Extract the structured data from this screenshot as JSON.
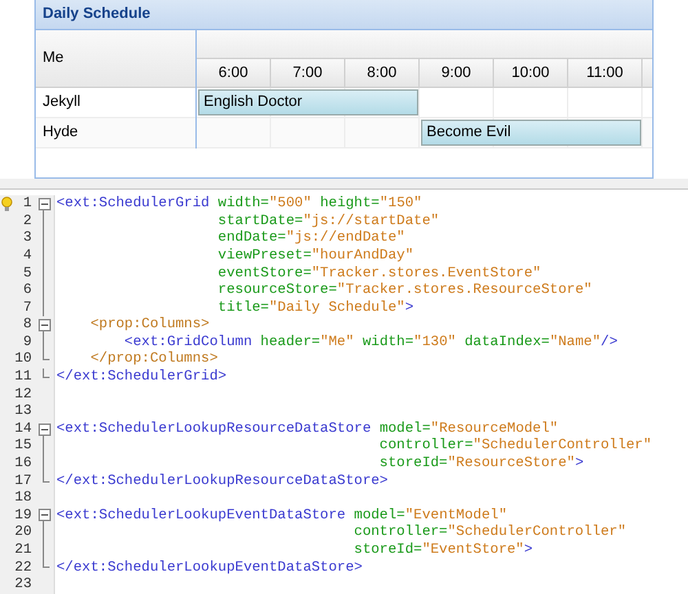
{
  "scheduler": {
    "title": "Daily Schedule",
    "resource_header": "Me",
    "hours": [
      "6:00",
      "7:00",
      "8:00",
      "9:00",
      "10:00",
      "11:00"
    ],
    "rows": [
      {
        "name": "Jekyll",
        "slots": [
          {
            "kind": "event_start",
            "text": "English Doctor"
          },
          {
            "kind": "event_cont"
          },
          {
            "kind": "event_cont"
          },
          {
            "kind": "empty"
          },
          {
            "kind": "empty"
          },
          {
            "kind": "empty"
          }
        ]
      },
      {
        "name": "Hyde",
        "slots": [
          {
            "kind": "empty"
          },
          {
            "kind": "empty"
          },
          {
            "kind": "empty"
          },
          {
            "kind": "event_start",
            "text": "Become Evil"
          },
          {
            "kind": "event_cont"
          },
          {
            "kind": "event_cont"
          }
        ]
      }
    ]
  },
  "editor": {
    "lines": [
      {
        "number": "1",
        "kind": "fold_start",
        "hint": true,
        "tokens": [
          {
            "kind": "tag",
            "text": "<ext:SchedulerGrid"
          },
          {
            "kind": "attr",
            "text": " width="
          },
          {
            "kind": "value",
            "text": "\"500\""
          },
          {
            "kind": "attr",
            "text": " height="
          },
          {
            "kind": "value",
            "text": "\"150\""
          }
        ]
      },
      {
        "number": "2",
        "kind": "fold_line",
        "tokens": [
          {
            "kind": "attr",
            "text": "                   startDate="
          },
          {
            "kind": "value",
            "text": "\"js://startDate\""
          }
        ]
      },
      {
        "number": "3",
        "kind": "fold_line",
        "tokens": [
          {
            "kind": "attr",
            "text": "                   endDate="
          },
          {
            "kind": "value",
            "text": "\"js://endDate\""
          }
        ]
      },
      {
        "number": "4",
        "kind": "fold_line",
        "tokens": [
          {
            "kind": "attr",
            "text": "                   viewPreset="
          },
          {
            "kind": "value",
            "text": "\"hourAndDay\""
          }
        ]
      },
      {
        "number": "5",
        "kind": "fold_line",
        "tokens": [
          {
            "kind": "attr",
            "text": "                   eventStore="
          },
          {
            "kind": "value",
            "text": "\"Tracker.stores.EventStore\""
          }
        ]
      },
      {
        "number": "6",
        "kind": "fold_line",
        "tokens": [
          {
            "kind": "attr",
            "text": "                   resourceStore="
          },
          {
            "kind": "value",
            "text": "\"Tracker.stores.ResourceStore\""
          }
        ]
      },
      {
        "number": "7",
        "kind": "fold_line",
        "tokens": [
          {
            "kind": "attr",
            "text": "                   title="
          },
          {
            "kind": "value",
            "text": "\"Daily Schedule\""
          },
          {
            "kind": "tag",
            "text": ">"
          }
        ]
      },
      {
        "number": "8",
        "kind": "fold_start",
        "tokens": [
          {
            "kind": "prop",
            "text": "    <prop:Columns>"
          }
        ]
      },
      {
        "number": "9",
        "kind": "fold_line",
        "tokens": [
          {
            "kind": "tag",
            "text": "        <ext:GridColumn"
          },
          {
            "kind": "attr",
            "text": " header="
          },
          {
            "kind": "value",
            "text": "\"Me\""
          },
          {
            "kind": "attr",
            "text": " width="
          },
          {
            "kind": "value",
            "text": "\"130\""
          },
          {
            "kind": "attr",
            "text": " dataIndex="
          },
          {
            "kind": "value",
            "text": "\"Name\""
          },
          {
            "kind": "tag",
            "text": "/>"
          }
        ]
      },
      {
        "number": "10",
        "kind": "fold_end",
        "tokens": [
          {
            "kind": "prop",
            "text": "    </prop:Columns>"
          }
        ]
      },
      {
        "number": "11",
        "kind": "fold_end",
        "tokens": [
          {
            "kind": "tag",
            "text": "</ext:SchedulerGrid>"
          }
        ]
      },
      {
        "number": "12",
        "kind": "plain"
      },
      {
        "number": "13",
        "kind": "plain"
      },
      {
        "number": "14",
        "kind": "fold_start",
        "tokens": [
          {
            "kind": "tag",
            "text": "<ext:SchedulerLookupResourceDataStore"
          },
          {
            "kind": "attr",
            "text": " model="
          },
          {
            "kind": "value",
            "text": "\"ResourceModel\""
          }
        ]
      },
      {
        "number": "15",
        "kind": "fold_line",
        "tokens": [
          {
            "kind": "attr",
            "text": "                                      controller="
          },
          {
            "kind": "value",
            "text": "\"SchedulerController\""
          }
        ]
      },
      {
        "number": "16",
        "kind": "fold_line",
        "tokens": [
          {
            "kind": "attr",
            "text": "                                      storeId="
          },
          {
            "kind": "value",
            "text": "\"ResourceStore\""
          },
          {
            "kind": "tag",
            "text": ">"
          }
        ]
      },
      {
        "number": "17",
        "kind": "fold_end",
        "tokens": [
          {
            "kind": "tag",
            "text": "</ext:SchedulerLookupResourceDataStore>"
          }
        ]
      },
      {
        "number": "18",
        "kind": "plain"
      },
      {
        "number": "19",
        "kind": "fold_start",
        "tokens": [
          {
            "kind": "tag",
            "text": "<ext:SchedulerLookupEventDataStore"
          },
          {
            "kind": "attr",
            "text": " model="
          },
          {
            "kind": "value",
            "text": "\"EventModel\""
          }
        ]
      },
      {
        "number": "20",
        "kind": "fold_line",
        "tokens": [
          {
            "kind": "attr",
            "text": "                                   controller="
          },
          {
            "kind": "value",
            "text": "\"SchedulerController\""
          }
        ]
      },
      {
        "number": "21",
        "kind": "fold_line",
        "tokens": [
          {
            "kind": "attr",
            "text": "                                   storeId="
          },
          {
            "kind": "value",
            "text": "\"EventStore\""
          },
          {
            "kind": "tag",
            "text": ">"
          }
        ]
      },
      {
        "number": "22",
        "kind": "fold_end",
        "tokens": [
          {
            "kind": "tag",
            "text": "</ext:SchedulerLookupEventDataStore>"
          }
        ]
      },
      {
        "number": "23",
        "kind": "plain"
      }
    ]
  }
}
